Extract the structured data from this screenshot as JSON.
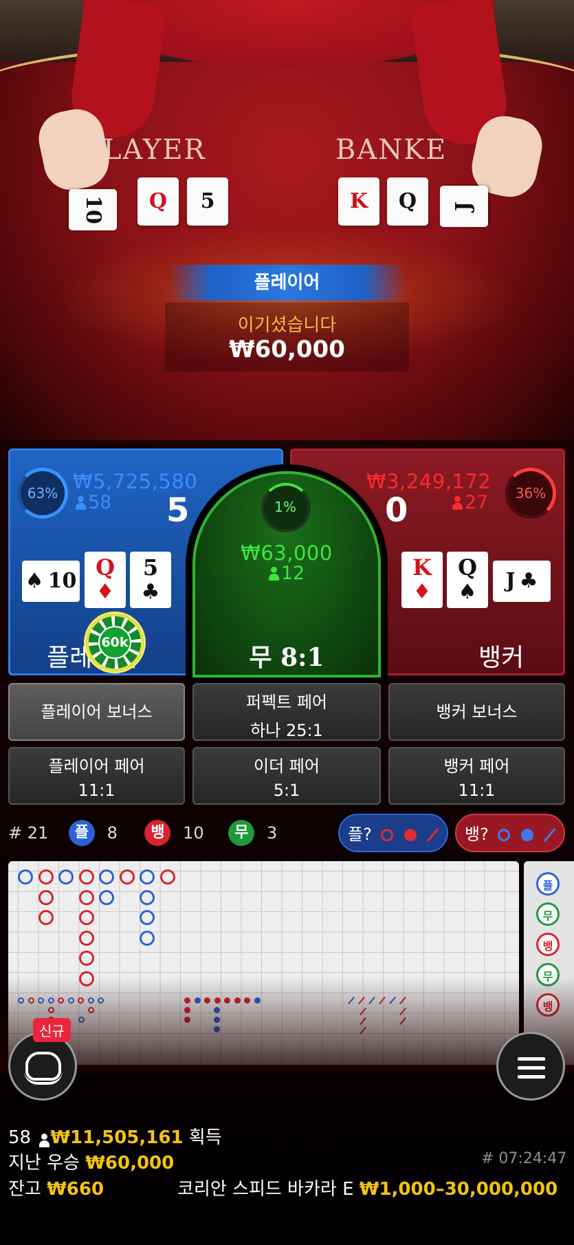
{
  "video": {
    "table_player": "LAYER",
    "table_banker": "BANKE",
    "banner": "플레이어",
    "win_text": "이기셨습니다",
    "win_amount": "₩60,000"
  },
  "player": {
    "percent": "63%",
    "amount": "₩5,725,580",
    "count": "58",
    "score": "5",
    "label": "플레이어",
    "cards": [
      {
        "rank": "10",
        "suit": "♠",
        "color": "black"
      },
      {
        "rank": "Q",
        "suit": "♦",
        "color": "red"
      },
      {
        "rank": "5",
        "suit": "♣",
        "color": "black"
      }
    ],
    "chip": "60k"
  },
  "tie": {
    "percent": "1%",
    "amount": "₩63,000",
    "count": "12",
    "label": "무 8:1"
  },
  "banker": {
    "percent": "36%",
    "amount": "₩3,249,172",
    "count": "27",
    "score": "0",
    "label": "뱅커",
    "cards": [
      {
        "rank": "K",
        "suit": "♦",
        "color": "red"
      },
      {
        "rank": "Q",
        "suit": "♠",
        "color": "black"
      },
      {
        "rank": "J",
        "suit": "♣",
        "color": "black"
      }
    ]
  },
  "side_bets": {
    "player_bonus": "플레이어 보너스",
    "perfect_pair": "퍼펙트 페어",
    "perfect_pair_odds": "하나 25:1",
    "banker_bonus": "뱅커 보너스",
    "player_pair": "플레이어 페어",
    "player_pair_odds": "11:1",
    "either_pair": "이더 페어",
    "either_pair_odds": "5:1",
    "banker_pair": "뱅커 페어",
    "banker_pair_odds": "11:1"
  },
  "stats": {
    "round": "# 21",
    "player_icon": "플",
    "player_count": "8",
    "banker_icon": "뱅",
    "banker_count": "10",
    "tie_icon": "무",
    "tie_count": "3",
    "ask_player": "플?",
    "ask_banker": "뱅?"
  },
  "road_side": [
    "플",
    "무",
    "뱅",
    "무",
    "뱅"
  ],
  "buttons": {
    "new_badge": "신규"
  },
  "footer": {
    "players": "58",
    "total_won": "₩11,505,161",
    "total_won_label": "획득",
    "last_win_label": "지난 우승",
    "last_win": "₩60,000",
    "time": "# 07:24:47",
    "balance_label": "잔고",
    "balance": "₩660",
    "table_name": "코리안 스피드 바카라 E",
    "limits": "₩1,000–30,000,000"
  },
  "colors": {
    "player": "#2064c4",
    "banker": "#8c1a24",
    "tie": "#1b6e1b",
    "gold": "#f2c316"
  }
}
